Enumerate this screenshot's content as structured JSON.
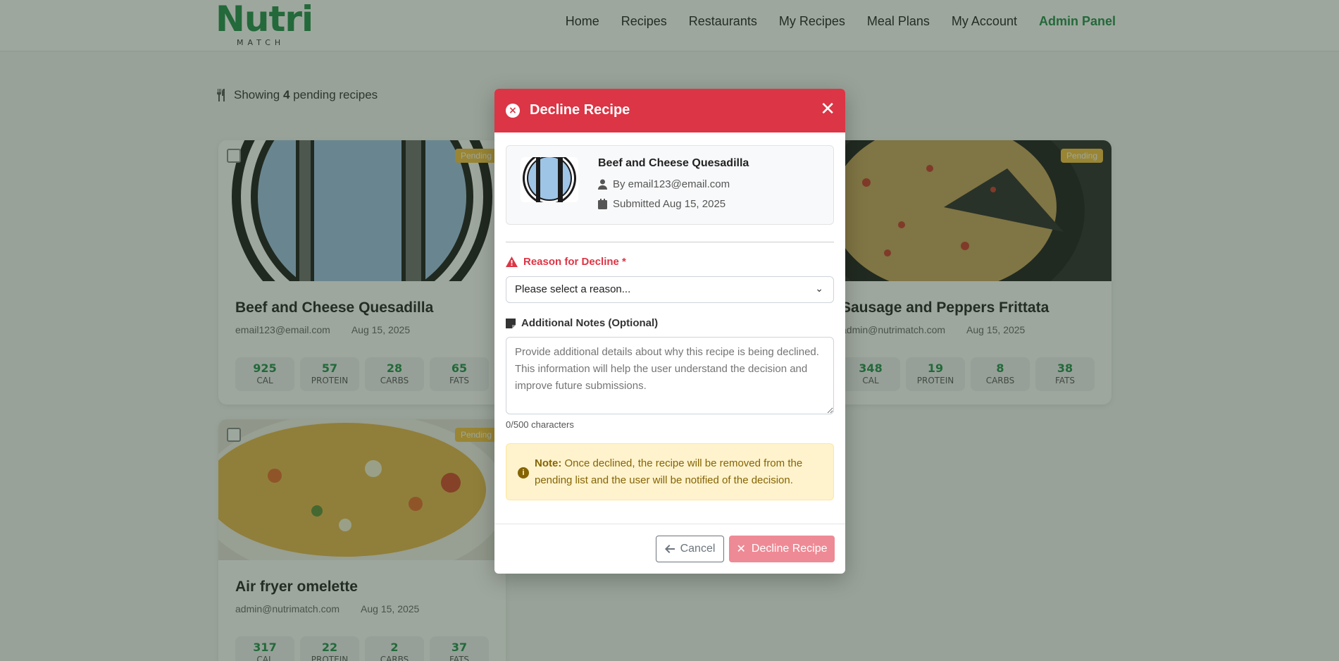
{
  "navbar": {
    "logo_word": "Nutri",
    "logo_sub": "MATCH",
    "links": [
      {
        "label": "Home"
      },
      {
        "label": "Recipes"
      },
      {
        "label": "Restaurants"
      },
      {
        "label": "My Recipes"
      },
      {
        "label": "Meal Plans"
      },
      {
        "label": "My Account"
      },
      {
        "label": "Admin Panel"
      }
    ]
  },
  "summary": {
    "prefix": "Showing",
    "count": "4",
    "suffix": "pending recipes"
  },
  "cards": [
    {
      "title": "Beef and Cheese Quesadilla",
      "author": "email123@email.com",
      "date": "Aug 15, 2025",
      "badge": "Pending",
      "stats": [
        {
          "value": "925",
          "label": "CAL"
        },
        {
          "value": "57",
          "label": "PROTEIN"
        },
        {
          "value": "28",
          "label": "CARBS"
        },
        {
          "value": "65",
          "label": "FATS"
        }
      ]
    },
    {
      "title": "Sausage and Peppers Frittata",
      "author": "admin@nutrimatch.com",
      "date": "Aug 15, 2025",
      "badge": "Pending",
      "stats": [
        {
          "value": "348",
          "label": "CAL"
        },
        {
          "value": "19",
          "label": "PROTEIN"
        },
        {
          "value": "8",
          "label": "CARBS"
        },
        {
          "value": "38",
          "label": "FATS"
        }
      ]
    },
    {
      "title": "Air fryer omelette",
      "author": "admin@nutrimatch.com",
      "date": "Aug 15, 2025",
      "badge": "Pending",
      "stats": [
        {
          "value": "317",
          "label": "CAL"
        },
        {
          "value": "22",
          "label": "PROTEIN"
        },
        {
          "value": "2",
          "label": "CARBS"
        },
        {
          "value": "37",
          "label": "FATS"
        }
      ]
    }
  ],
  "modal": {
    "title": "Decline Recipe",
    "recipe_name": "Beef and Cheese Quesadilla",
    "recipe_author": "By email123@email.com",
    "recipe_submitted": "Submitted Aug 15, 2025",
    "reason_label": "Reason for Decline *",
    "reason_placeholder": "Please select a reason...",
    "notes_label": "Additional Notes (Optional)",
    "notes_placeholder": "Provide additional details about why this recipe is being declined. This information will help the user understand the decision and improve future submissions.",
    "counter": "0/500 characters",
    "note_bold": "Note:",
    "note_text": "Once declined, the recipe will be removed from the pending list and the user will be notified of the decision.",
    "cancel_label": "Cancel",
    "decline_label": "Decline Recipe"
  },
  "colors": {
    "brand_green": "#1f8f4a",
    "danger": "#dc3545",
    "warning_bg": "#fff3cd",
    "badge": "#f6c23e"
  }
}
